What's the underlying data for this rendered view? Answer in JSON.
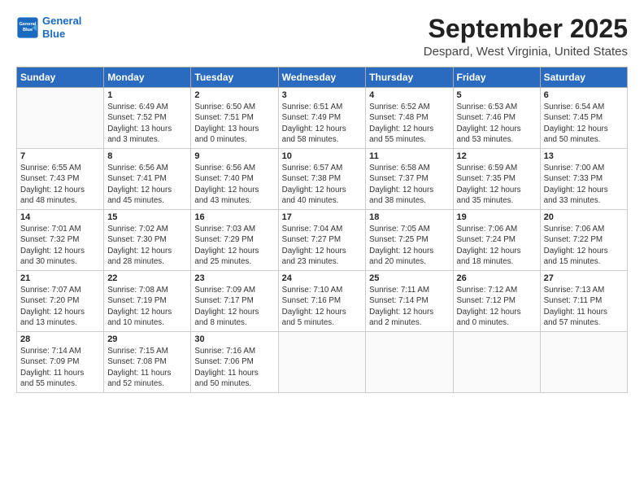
{
  "header": {
    "logo_line1": "General",
    "logo_line2": "Blue",
    "main_title": "September 2025",
    "subtitle": "Despard, West Virginia, United States"
  },
  "weekdays": [
    "Sunday",
    "Monday",
    "Tuesday",
    "Wednesday",
    "Thursday",
    "Friday",
    "Saturday"
  ],
  "weeks": [
    [
      {
        "day": "",
        "info": ""
      },
      {
        "day": "1",
        "info": "Sunrise: 6:49 AM\nSunset: 7:52 PM\nDaylight: 13 hours\nand 3 minutes."
      },
      {
        "day": "2",
        "info": "Sunrise: 6:50 AM\nSunset: 7:51 PM\nDaylight: 13 hours\nand 0 minutes."
      },
      {
        "day": "3",
        "info": "Sunrise: 6:51 AM\nSunset: 7:49 PM\nDaylight: 12 hours\nand 58 minutes."
      },
      {
        "day": "4",
        "info": "Sunrise: 6:52 AM\nSunset: 7:48 PM\nDaylight: 12 hours\nand 55 minutes."
      },
      {
        "day": "5",
        "info": "Sunrise: 6:53 AM\nSunset: 7:46 PM\nDaylight: 12 hours\nand 53 minutes."
      },
      {
        "day": "6",
        "info": "Sunrise: 6:54 AM\nSunset: 7:45 PM\nDaylight: 12 hours\nand 50 minutes."
      }
    ],
    [
      {
        "day": "7",
        "info": "Sunrise: 6:55 AM\nSunset: 7:43 PM\nDaylight: 12 hours\nand 48 minutes."
      },
      {
        "day": "8",
        "info": "Sunrise: 6:56 AM\nSunset: 7:41 PM\nDaylight: 12 hours\nand 45 minutes."
      },
      {
        "day": "9",
        "info": "Sunrise: 6:56 AM\nSunset: 7:40 PM\nDaylight: 12 hours\nand 43 minutes."
      },
      {
        "day": "10",
        "info": "Sunrise: 6:57 AM\nSunset: 7:38 PM\nDaylight: 12 hours\nand 40 minutes."
      },
      {
        "day": "11",
        "info": "Sunrise: 6:58 AM\nSunset: 7:37 PM\nDaylight: 12 hours\nand 38 minutes."
      },
      {
        "day": "12",
        "info": "Sunrise: 6:59 AM\nSunset: 7:35 PM\nDaylight: 12 hours\nand 35 minutes."
      },
      {
        "day": "13",
        "info": "Sunrise: 7:00 AM\nSunset: 7:33 PM\nDaylight: 12 hours\nand 33 minutes."
      }
    ],
    [
      {
        "day": "14",
        "info": "Sunrise: 7:01 AM\nSunset: 7:32 PM\nDaylight: 12 hours\nand 30 minutes."
      },
      {
        "day": "15",
        "info": "Sunrise: 7:02 AM\nSunset: 7:30 PM\nDaylight: 12 hours\nand 28 minutes."
      },
      {
        "day": "16",
        "info": "Sunrise: 7:03 AM\nSunset: 7:29 PM\nDaylight: 12 hours\nand 25 minutes."
      },
      {
        "day": "17",
        "info": "Sunrise: 7:04 AM\nSunset: 7:27 PM\nDaylight: 12 hours\nand 23 minutes."
      },
      {
        "day": "18",
        "info": "Sunrise: 7:05 AM\nSunset: 7:25 PM\nDaylight: 12 hours\nand 20 minutes."
      },
      {
        "day": "19",
        "info": "Sunrise: 7:06 AM\nSunset: 7:24 PM\nDaylight: 12 hours\nand 18 minutes."
      },
      {
        "day": "20",
        "info": "Sunrise: 7:06 AM\nSunset: 7:22 PM\nDaylight: 12 hours\nand 15 minutes."
      }
    ],
    [
      {
        "day": "21",
        "info": "Sunrise: 7:07 AM\nSunset: 7:20 PM\nDaylight: 12 hours\nand 13 minutes."
      },
      {
        "day": "22",
        "info": "Sunrise: 7:08 AM\nSunset: 7:19 PM\nDaylight: 12 hours\nand 10 minutes."
      },
      {
        "day": "23",
        "info": "Sunrise: 7:09 AM\nSunset: 7:17 PM\nDaylight: 12 hours\nand 8 minutes."
      },
      {
        "day": "24",
        "info": "Sunrise: 7:10 AM\nSunset: 7:16 PM\nDaylight: 12 hours\nand 5 minutes."
      },
      {
        "day": "25",
        "info": "Sunrise: 7:11 AM\nSunset: 7:14 PM\nDaylight: 12 hours\nand 2 minutes."
      },
      {
        "day": "26",
        "info": "Sunrise: 7:12 AM\nSunset: 7:12 PM\nDaylight: 12 hours\nand 0 minutes."
      },
      {
        "day": "27",
        "info": "Sunrise: 7:13 AM\nSunset: 7:11 PM\nDaylight: 11 hours\nand 57 minutes."
      }
    ],
    [
      {
        "day": "28",
        "info": "Sunrise: 7:14 AM\nSunset: 7:09 PM\nDaylight: 11 hours\nand 55 minutes."
      },
      {
        "day": "29",
        "info": "Sunrise: 7:15 AM\nSunset: 7:08 PM\nDaylight: 11 hours\nand 52 minutes."
      },
      {
        "day": "30",
        "info": "Sunrise: 7:16 AM\nSunset: 7:06 PM\nDaylight: 11 hours\nand 50 minutes."
      },
      {
        "day": "",
        "info": ""
      },
      {
        "day": "",
        "info": ""
      },
      {
        "day": "",
        "info": ""
      },
      {
        "day": "",
        "info": ""
      }
    ]
  ]
}
